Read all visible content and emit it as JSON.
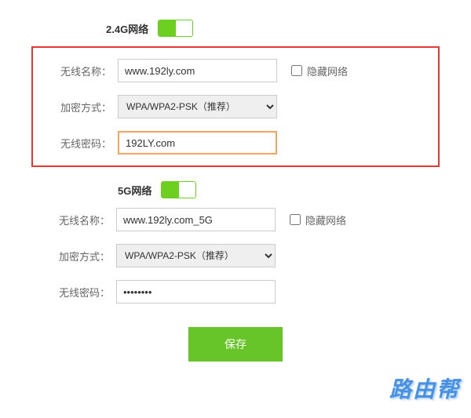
{
  "wifi24": {
    "title": "2.4G网络",
    "toggle_on": true,
    "ssid_label": "无线名称：",
    "ssid_value": "www.192ly.com",
    "hide_label": "隐藏网络",
    "hide_checked": false,
    "enc_label": "加密方式：",
    "enc_value": "WPA/WPA2-PSK（推荐）",
    "pwd_label": "无线密码：",
    "pwd_value": "192LY.com"
  },
  "wifi5": {
    "title": "5G网络",
    "toggle_on": true,
    "ssid_label": "无线名称：",
    "ssid_value": "www.192ly.com_5G",
    "hide_label": "隐藏网络",
    "hide_checked": false,
    "enc_label": "加密方式：",
    "enc_value": "WPA/WPA2-PSK（推荐）",
    "pwd_label": "无线密码：",
    "pwd_value": "••••••••"
  },
  "actions": {
    "save_label": "保存"
  },
  "watermark": "路由帮"
}
